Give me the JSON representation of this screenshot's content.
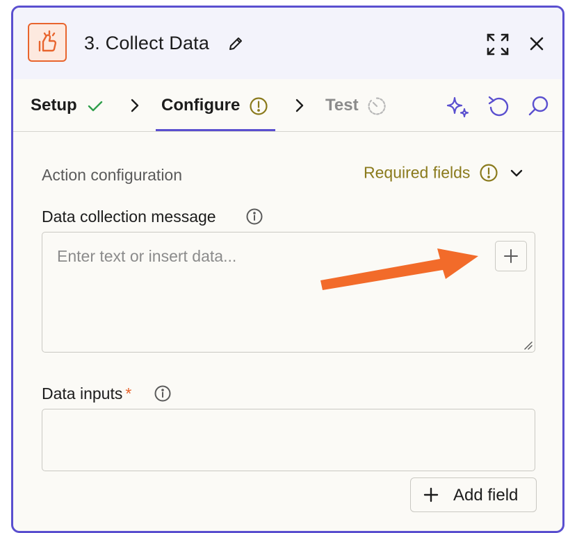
{
  "header": {
    "app_icon": "thumbs-up-spark-icon",
    "title": "3. Collect Data",
    "edit_icon": "pencil-icon",
    "expand_icon": "expand-icon",
    "close_icon": "close-icon"
  },
  "tabs": [
    {
      "label": "Setup",
      "status_icon": "checkmark-icon",
      "state": "complete"
    },
    {
      "label": "Configure",
      "status_icon": "warning-circle-icon",
      "state": "active"
    },
    {
      "label": "Test",
      "status_icon": "timer-icon",
      "state": "disabled"
    }
  ],
  "toolbar": {
    "icons": [
      "sparkles-icon",
      "undo-icon",
      "search-icon"
    ]
  },
  "section": {
    "title": "Action configuration",
    "required_label": "Required fields",
    "required_icon": "warning-circle-icon"
  },
  "fields": {
    "message": {
      "label": "Data collection message",
      "placeholder": "Enter text or insert data..."
    },
    "inputs": {
      "label": "Data inputs",
      "required_mark": "*"
    },
    "add_field_label": "Add field"
  },
  "colors": {
    "accent": "#5a4fcf",
    "brand": "#e8642d",
    "warning": "#8a7a1c",
    "success": "#2e9e4b",
    "annotation_arrow": "#f26b2a"
  }
}
